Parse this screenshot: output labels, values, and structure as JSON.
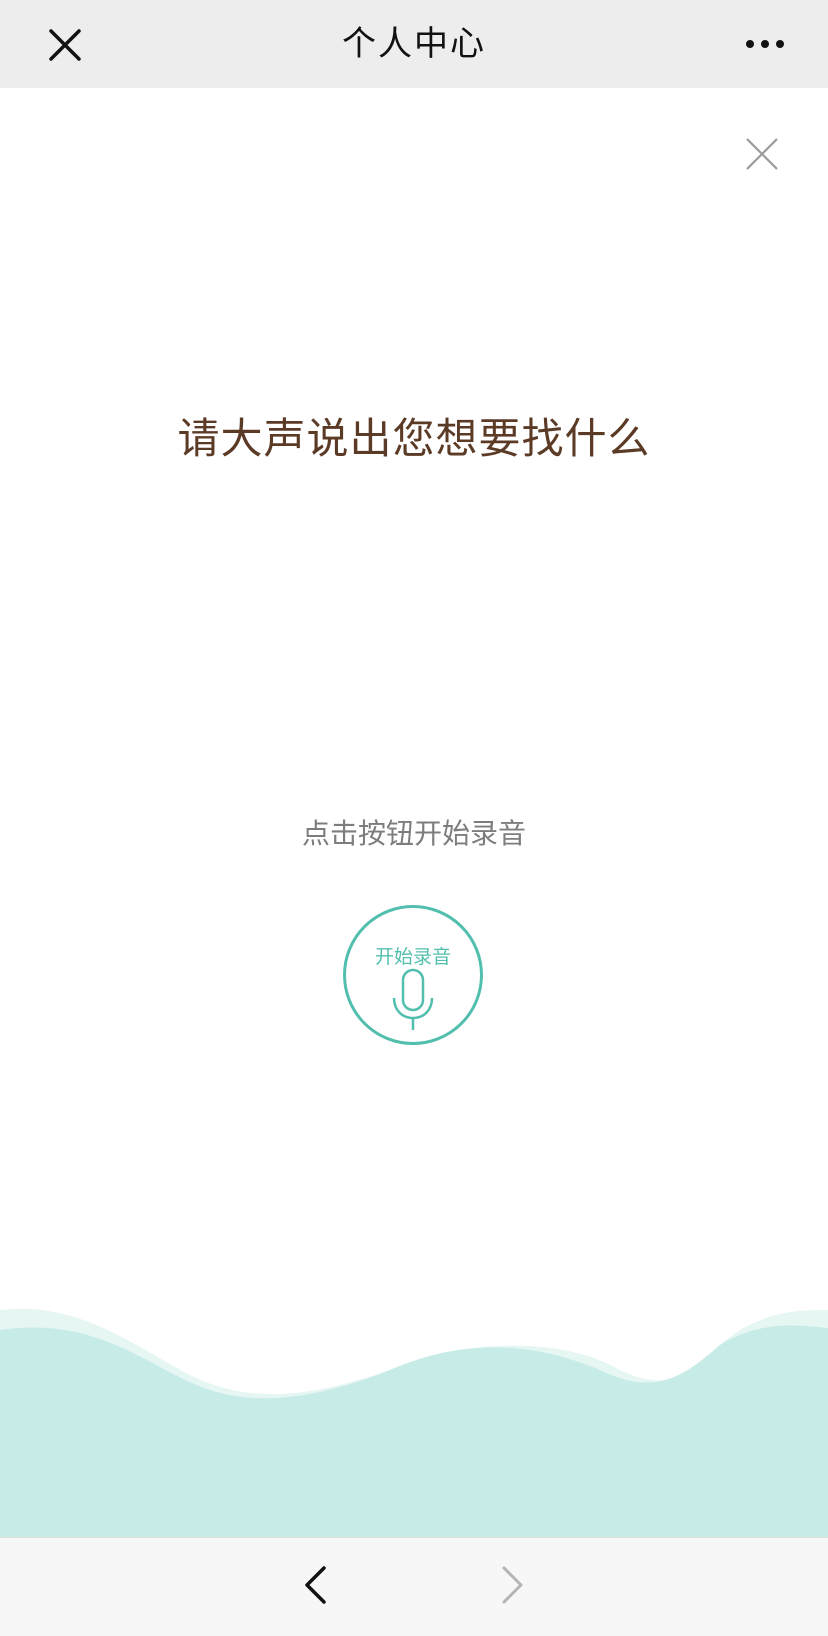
{
  "header": {
    "title": "个人中心",
    "close_icon": "close-icon",
    "more_icon": "more-icon"
  },
  "modal": {
    "close_icon": "close-icon",
    "prompt": "请大声说出您想要找什么",
    "hint": "点击按钮开始录音",
    "record_button": {
      "label": "开始录音",
      "icon": "microphone-icon"
    }
  },
  "nav": {
    "back_icon": "chevron-left-icon",
    "forward_icon": "chevron-right-icon"
  },
  "colors": {
    "accent": "#52bfae",
    "prompt_text": "#5b3a26",
    "wave_back": "#e5f6f3",
    "wave_front": "#c7ebe7",
    "header_bg": "#ededed"
  }
}
